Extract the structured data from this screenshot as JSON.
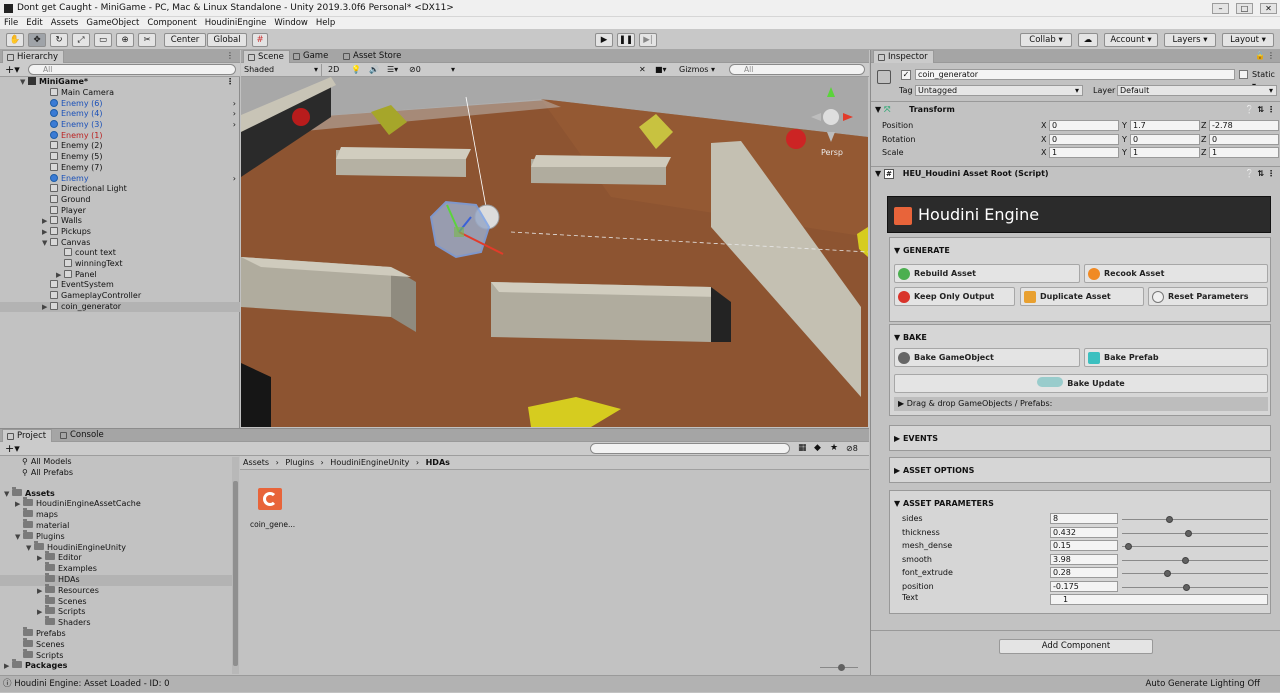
{
  "window": {
    "title": "Dont get Caught - MiniGame - PC, Mac & Linux Standalone - Unity 2019.3.0f6 Personal* <DX11>"
  },
  "menu": [
    "File",
    "Edit",
    "Assets",
    "GameObject",
    "Component",
    "HoudiniEngine",
    "Window",
    "Help"
  ],
  "toolbar": {
    "center_label": "Center",
    "global_label": "Global",
    "collab_label": "Collab",
    "account_label": "Account",
    "layers_label": "Layers",
    "layout_label": "Layout"
  },
  "hierarchy": {
    "tab": "Hierarchy",
    "search_placeholder": "All",
    "scene": "MiniGame*",
    "items": [
      {
        "label": "Main Camera",
        "color": "normal",
        "indent": 2,
        "arrow": ""
      },
      {
        "label": "Enemy (6)",
        "color": "blue",
        "indent": 2,
        "arrow": "›"
      },
      {
        "label": "Enemy (4)",
        "color": "blue",
        "indent": 2,
        "arrow": "›"
      },
      {
        "label": "Enemy (3)",
        "color": "blue",
        "indent": 2,
        "arrow": "›"
      },
      {
        "label": "Enemy (1)",
        "color": "red",
        "indent": 2,
        "arrow": ""
      },
      {
        "label": "Enemy (2)",
        "color": "normal",
        "indent": 2,
        "arrow": ""
      },
      {
        "label": "Enemy (5)",
        "color": "normal",
        "indent": 2,
        "arrow": ""
      },
      {
        "label": "Enemy (7)",
        "color": "normal",
        "indent": 2,
        "arrow": ""
      },
      {
        "label": "Enemy",
        "color": "blue",
        "indent": 2,
        "arrow": "›"
      },
      {
        "label": "Directional Light",
        "color": "normal",
        "indent": 2,
        "arrow": ""
      },
      {
        "label": "Ground",
        "color": "normal",
        "indent": 2,
        "arrow": ""
      },
      {
        "label": "Player",
        "color": "normal",
        "indent": 2,
        "arrow": ""
      },
      {
        "label": "Walls",
        "color": "normal",
        "indent": 2,
        "arrow": ""
      },
      {
        "label": "Pickups",
        "color": "normal",
        "indent": 2,
        "arrow": ""
      },
      {
        "label": "Canvas",
        "color": "normal",
        "indent": 2,
        "arrow": ""
      },
      {
        "label": "count text",
        "color": "normal",
        "indent": 3,
        "arrow": ""
      },
      {
        "label": "winningText",
        "color": "normal",
        "indent": 3,
        "arrow": ""
      },
      {
        "label": "Panel",
        "color": "normal",
        "indent": 3,
        "arrow": ""
      },
      {
        "label": "EventSystem",
        "color": "normal",
        "indent": 2,
        "arrow": ""
      },
      {
        "label": "GameplayController",
        "color": "normal",
        "indent": 2,
        "arrow": ""
      },
      {
        "label": "coin_generator",
        "color": "normal",
        "indent": 2,
        "arrow": ""
      }
    ]
  },
  "scene_view": {
    "tabs": [
      "Scene",
      "Game",
      "Asset Store"
    ],
    "shading": "Shaded",
    "mode_2d": "2D",
    "gizmos_label": "Gizmos",
    "search_placeholder": "All",
    "persp_label": "Persp",
    "layers_count": "0"
  },
  "project": {
    "tabs": [
      "Project",
      "Console"
    ],
    "favorites": [
      "All Models",
      "All Prefabs"
    ],
    "tree": [
      {
        "label": "Assets",
        "indent": 0,
        "bold": true
      },
      {
        "label": "HoudiniEngineAssetCache",
        "indent": 1,
        "bold": false
      },
      {
        "label": "maps",
        "indent": 1,
        "bold": false
      },
      {
        "label": "material",
        "indent": 1,
        "bold": false
      },
      {
        "label": "Plugins",
        "indent": 1,
        "bold": false
      },
      {
        "label": "HoudiniEngineUnity",
        "indent": 2,
        "bold": false
      },
      {
        "label": "Editor",
        "indent": 3,
        "bold": false
      },
      {
        "label": "Examples",
        "indent": 3,
        "bold": false
      },
      {
        "label": "HDAs",
        "indent": 3,
        "bold": false
      },
      {
        "label": "Resources",
        "indent": 3,
        "bold": false
      },
      {
        "label": "Scenes",
        "indent": 3,
        "bold": false
      },
      {
        "label": "Scripts",
        "indent": 3,
        "bold": false
      },
      {
        "label": "Shaders",
        "indent": 3,
        "bold": false
      },
      {
        "label": "Prefabs",
        "indent": 1,
        "bold": false
      },
      {
        "label": "Scenes",
        "indent": 1,
        "bold": false
      },
      {
        "label": "Scripts",
        "indent": 1,
        "bold": false
      },
      {
        "label": "Packages",
        "indent": 0,
        "bold": true
      }
    ],
    "breadcrumb": [
      "Assets",
      "Plugins",
      "HoudiniEngineUnity",
      "HDAs"
    ],
    "asset_name": "coin_gene...",
    "hidden_count": "8"
  },
  "inspector": {
    "tab": "Inspector",
    "object_name": "coin_generator",
    "static_label": "Static",
    "tag_label": "Tag",
    "tag_value": "Untagged",
    "layer_label": "Layer",
    "layer_value": "Default",
    "transform": {
      "title": "Transform",
      "position": {
        "label": "Position",
        "x": "0",
        "y": "1.7",
        "z": "-2.78"
      },
      "rotation": {
        "label": "Rotation",
        "x": "0",
        "y": "0",
        "z": "0"
      },
      "scale": {
        "label": "Scale",
        "x": "1",
        "y": "1",
        "z": "1"
      }
    },
    "script_title": "HEU_Houdini Asset Root (Script)",
    "houdini_header": "Houdini Engine",
    "generate": {
      "title": "GENERATE",
      "rebuild": "Rebuild Asset",
      "recook": "Recook Asset",
      "keep_output": "Keep Only Output",
      "duplicate": "Duplicate Asset",
      "reset": "Reset Parameters"
    },
    "bake": {
      "title": "BAKE",
      "bake_go": "Bake GameObject",
      "bake_prefab": "Bake Prefab",
      "bake_update": "Bake Update",
      "drag_drop": "Drag & drop GameObjects / Prefabs:"
    },
    "events_title": "EVENTS",
    "asset_options_title": "ASSET OPTIONS",
    "parameters": {
      "title": "ASSET PARAMETERS",
      "items": [
        {
          "label": "sides",
          "value": "8",
          "fraction": 0.29
        },
        {
          "label": "thickness",
          "value": "0.432",
          "fraction": 0.42
        },
        {
          "label": "mesh_dense",
          "value": "0.15",
          "fraction": 0.02
        },
        {
          "label": "smooth",
          "value": "3.98",
          "fraction": 0.4
        },
        {
          "label": "font_extrude",
          "value": "0.28",
          "fraction": 0.28
        },
        {
          "label": "position",
          "value": "-0.175",
          "fraction": 0.41
        }
      ],
      "text_label": "Text",
      "text_value": "1"
    },
    "add_component": "Add Component"
  },
  "status": {
    "left": "Houdini Engine: Asset Loaded - ID: 0",
    "right": "Auto Generate Lighting Off"
  }
}
